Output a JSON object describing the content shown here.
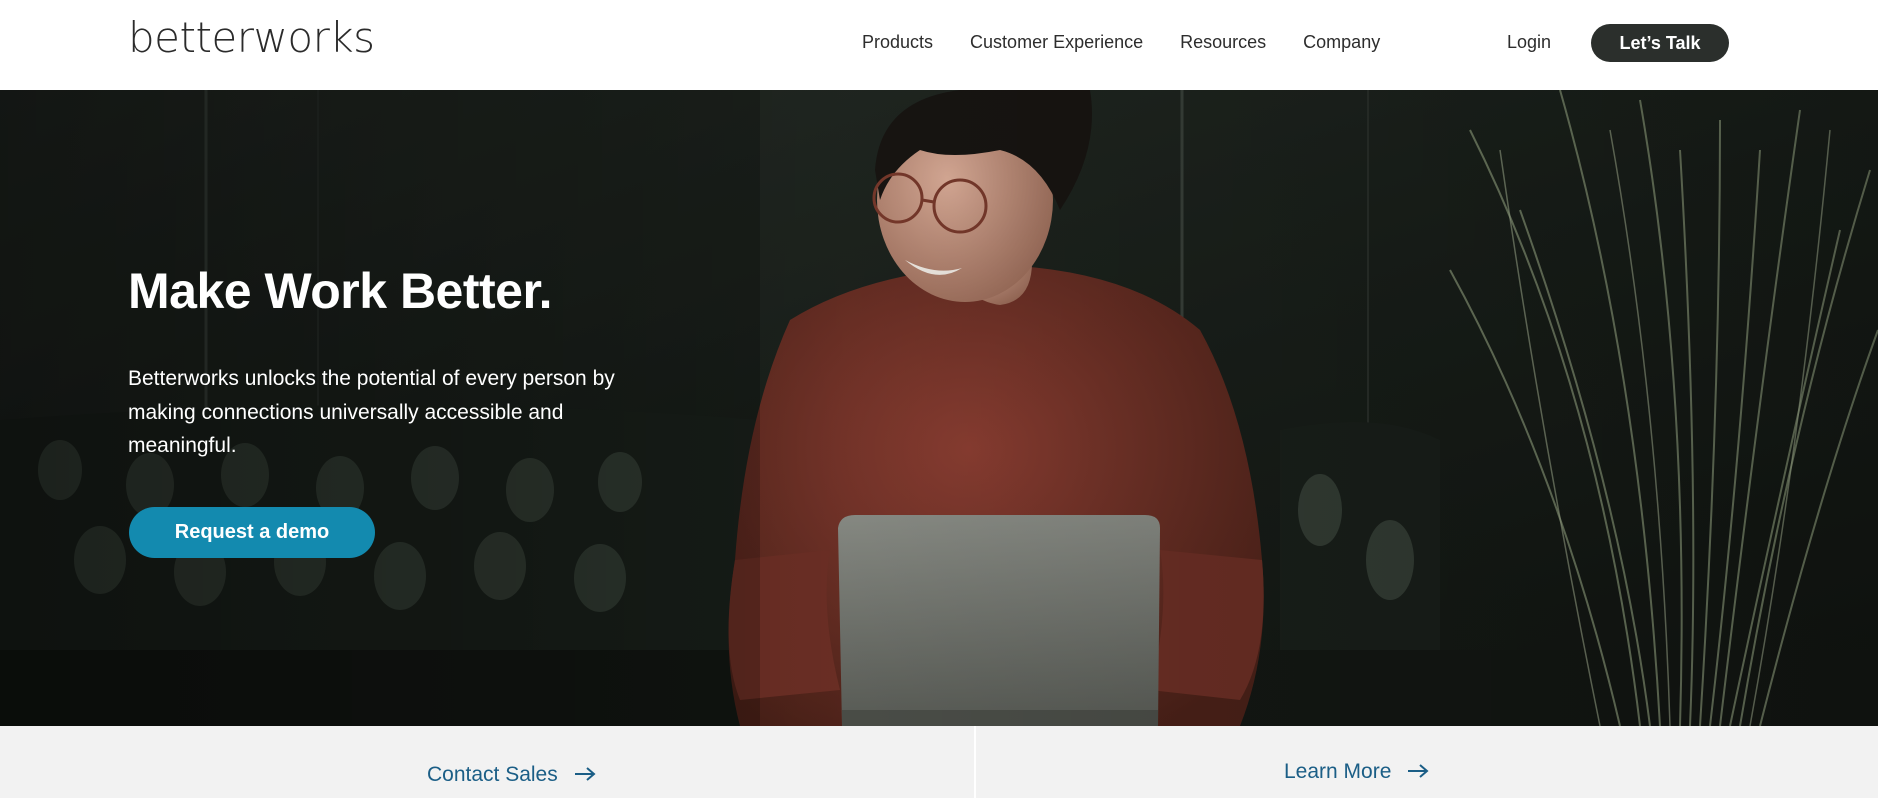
{
  "header": {
    "logo": "betterworks",
    "nav": [
      "Products",
      "Customer Experience",
      "Resources",
      "Company"
    ],
    "login": "Login",
    "cta": "Let’s Talk"
  },
  "hero": {
    "title": "Make Work Better.",
    "description": "Betterworks unlocks the potential of every person by making connections universally accessible and meaningful.",
    "button": "Request a demo"
  },
  "footer_links": {
    "contact": "Contact Sales",
    "learn": "Learn More"
  },
  "colors": {
    "cta_dark": "#2b2f2c",
    "primary_button": "#138aaf",
    "link": "#1b5e86",
    "bottom_bar": "#f2f2f2"
  },
  "icons": [
    "arrow-right-icon"
  ]
}
